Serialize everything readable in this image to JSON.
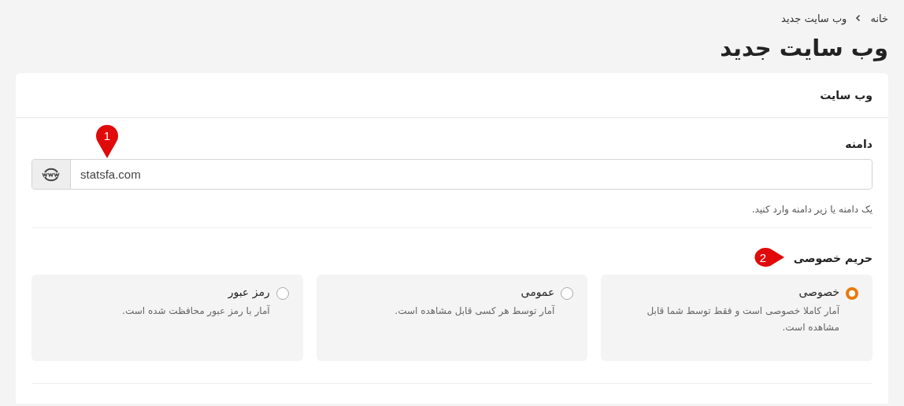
{
  "breadcrumb": [
    {
      "label": "خانه"
    },
    {
      "label": "وب سایت جدید"
    }
  ],
  "page_title": "وب سایت جدید",
  "card": {
    "title": "وب سایت",
    "domain": {
      "label": "دامنه",
      "value": "statsfa.com",
      "help": "یک دامنه یا زیر دامنه وارد کنید.",
      "marker": "1"
    },
    "privacy": {
      "label": "حریم خصوصی",
      "marker": "2",
      "options": [
        {
          "title": "خصوصی",
          "description": "آمار کاملا خصوصی است و فقط توسط شما قابل مشاهده است.",
          "selected": true
        },
        {
          "title": "عمومی",
          "description": "آمار توسط هر کسی قابل مشاهده است.",
          "selected": false
        },
        {
          "title": "رمز عبور",
          "description": "آمار با رمز عبور محافظت شده است.",
          "selected": false
        }
      ]
    }
  }
}
